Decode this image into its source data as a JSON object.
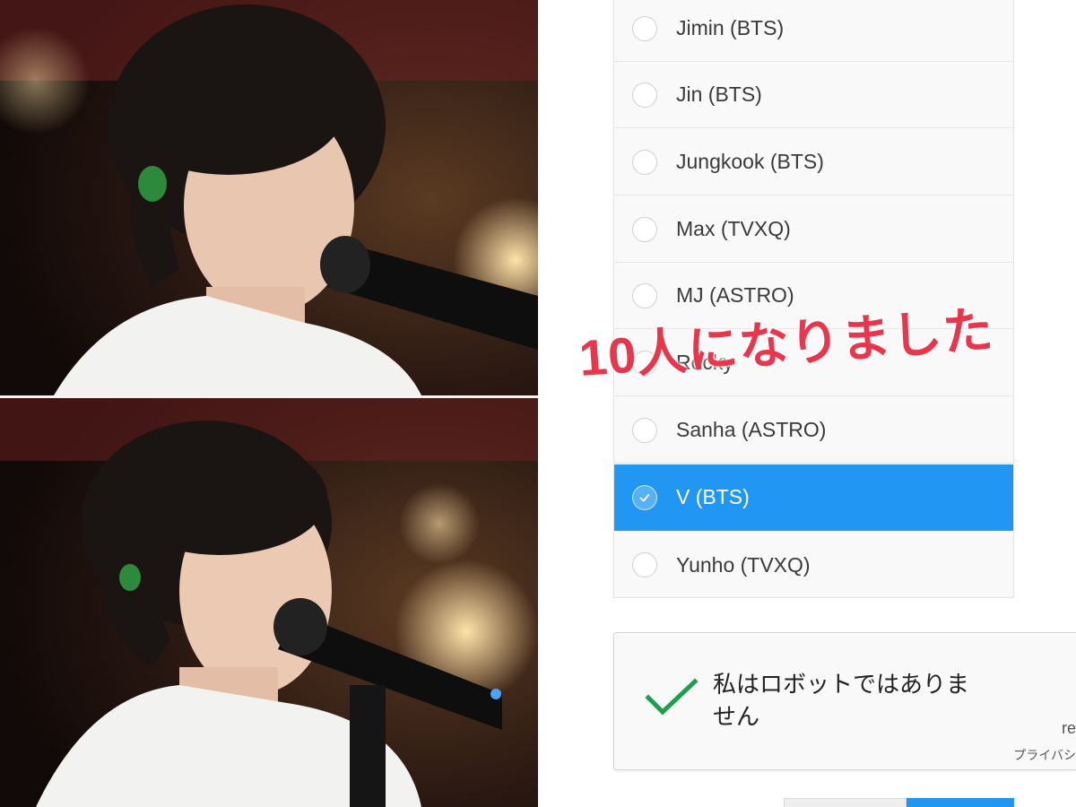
{
  "poll": {
    "options": [
      {
        "label": "Jimin (BTS)",
        "selected": false
      },
      {
        "label": "Jin (BTS)",
        "selected": false
      },
      {
        "label": "Jungkook (BTS)",
        "selected": false
      },
      {
        "label": "Max (TVXQ)",
        "selected": false
      },
      {
        "label": "MJ (ASTRO)",
        "selected": false
      },
      {
        "label": "Rocky",
        "selected": false
      },
      {
        "label": "Sanha (ASTRO)",
        "selected": false
      },
      {
        "label": "V (BTS)",
        "selected": true
      },
      {
        "label": "Yunho (TVXQ)",
        "selected": false
      }
    ],
    "selected_color": "#2196f3"
  },
  "overlay": {
    "caption": "10人になりました",
    "color": "#e8364c"
  },
  "captcha": {
    "label": "私はロボットではありません",
    "brand_fragment": "re",
    "privacy_fragment": "プライバシ",
    "checked": true,
    "check_color": "#1e9e4f"
  },
  "photos": {
    "top_icon": "performer-photo",
    "bottom_icon": "performer-photo"
  }
}
